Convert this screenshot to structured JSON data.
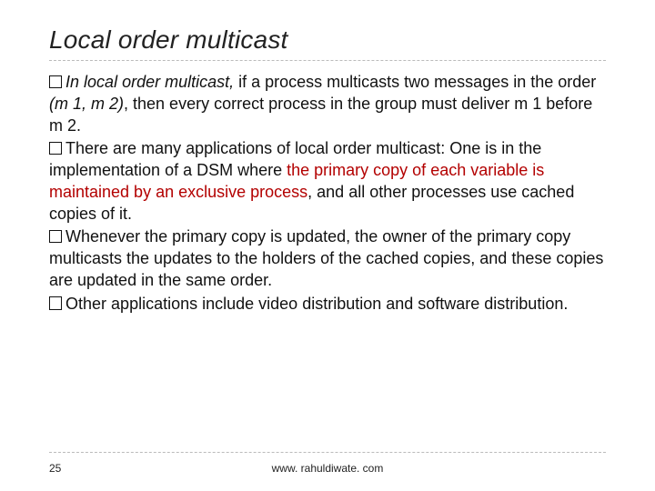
{
  "title": "Local order multicast",
  "bullets": {
    "b1": {
      "lead": "In local order multicast,",
      "rest1": " if a process multicasts two messages in the order ",
      "m": "(m 1, m 2)",
      "rest2": ", then every correct process in the group must deliver m 1 before m 2."
    },
    "b2": {
      "t1": "There are many applications of local order multicast: One is in the implementation of a DSM where ",
      "r1": "the primary copy of each variable is maintained by an exclusive process",
      "t2": ", and all other processes use cached copies of it."
    },
    "b3": {
      "text": "Whenever the primary copy is updated, the owner of the primary copy multicasts the updates to the holders of the cached copies, and these copies are updated in the same order."
    },
    "b4": {
      "text": "Other applications include video distribution and software distribution."
    }
  },
  "footer": {
    "page": "25",
    "url": "www. rahuldiwate. com"
  }
}
